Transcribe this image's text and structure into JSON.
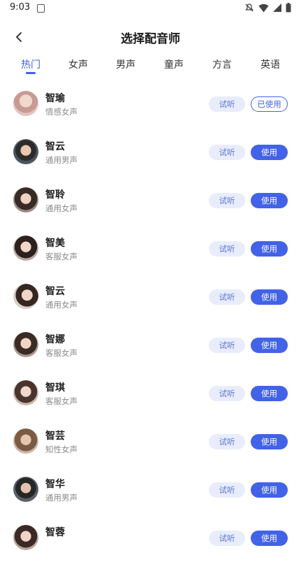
{
  "status": {
    "time": "9:03"
  },
  "header": {
    "title": "选择配音师"
  },
  "tabs": [
    "热门",
    "女声",
    "男声",
    "童声",
    "方言",
    "英语"
  ],
  "active_tab": "热门",
  "voices": [
    {
      "name": "智瑜",
      "type": "情感女声",
      "try": "试听",
      "action": "已使用"
    },
    {
      "name": "智云",
      "type": "通用男声",
      "try": "试听",
      "action": "使用"
    },
    {
      "name": "智聆",
      "type": "通用女声",
      "try": "试听",
      "action": "使用"
    },
    {
      "name": "智美",
      "type": "客服女声",
      "try": "试听",
      "action": "使用"
    },
    {
      "name": "智云",
      "type": "通用女声",
      "try": "试听",
      "action": "使用"
    },
    {
      "name": "智娜",
      "type": "客服女声",
      "try": "试听",
      "action": "使用"
    },
    {
      "name": "智琪",
      "type": "客服女声",
      "try": "试听",
      "action": "使用"
    },
    {
      "name": "智芸",
      "type": "知性女声",
      "try": "试听",
      "action": "使用"
    },
    {
      "name": "智华",
      "type": "通用男声",
      "try": "试听",
      "action": "使用"
    },
    {
      "name": "智蓉",
      "type": "",
      "try": "试听",
      "action": "使用"
    }
  ],
  "colors": {
    "accent": "#4262e8",
    "try_bg": "#e9edfb"
  }
}
